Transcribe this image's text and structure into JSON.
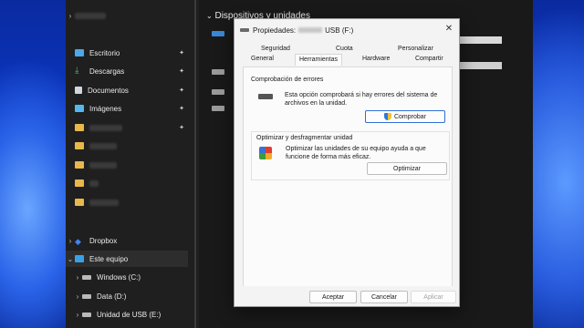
{
  "explorer": {
    "section_title": "Dispositivos y unidades",
    "nav": {
      "pinned": [
        {
          "label": "Escritorio",
          "icon": "desktop-icon"
        },
        {
          "label": "Descargas",
          "icon": "download-icon"
        },
        {
          "label": "Documentos",
          "icon": "documents-icon"
        },
        {
          "label": "Imágenes",
          "icon": "pictures-icon"
        }
      ],
      "dropbox": "Dropbox",
      "this_pc": "Este equipo",
      "drives": [
        {
          "label": "Windows (C:)"
        },
        {
          "label": "Data (D:)"
        },
        {
          "label": "Unidad de USB (E:)"
        }
      ]
    }
  },
  "dialog": {
    "title_prefix": "Propiedades:",
    "title_suffix": "USB (F:)",
    "close_label": "✕",
    "tabs_row1": [
      "Seguridad",
      "Cuota",
      "Personalizar"
    ],
    "tabs_row2": [
      "General",
      "Herramientas",
      "Hardware",
      "Compartir"
    ],
    "error_check": {
      "title": "Comprobación de errores",
      "text": "Esta opción comprobará si hay errores del sistema de archivos en la unidad.",
      "button": "Comprobar"
    },
    "optimize": {
      "title": "Optimizar y desfragmentar unidad",
      "text": "Optimizar las unidades de su equipo ayuda a que funcione de forma más eficaz.",
      "button": "Optimizar"
    },
    "footer": {
      "accept": "Aceptar",
      "cancel": "Cancelar",
      "apply": "Aplicar"
    }
  }
}
